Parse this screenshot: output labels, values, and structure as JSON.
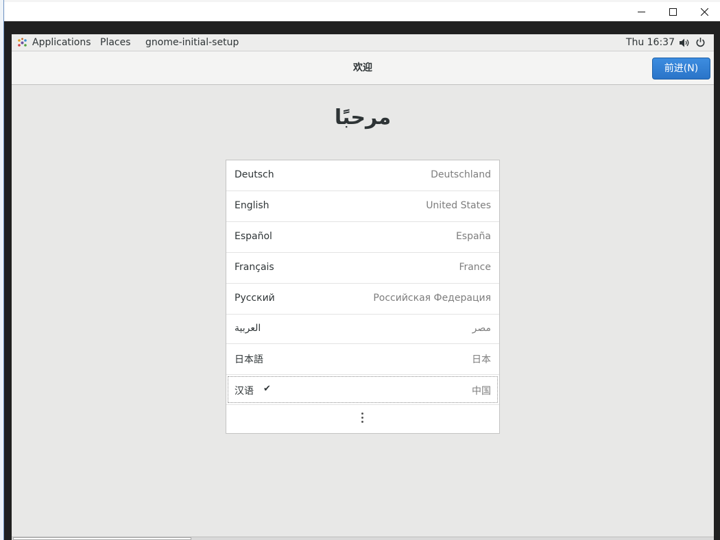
{
  "host_window": {
    "minimize_icon": "minimize-icon",
    "maximize_icon": "maximize-icon",
    "close_icon": "close-icon"
  },
  "topbar": {
    "applications_label": "Applications",
    "places_label": "Places",
    "app_name": "gnome-initial-setup",
    "clock": "Thu 16:37",
    "volume_icon": "volume-icon",
    "power_icon": "power-icon"
  },
  "headerbar": {
    "title": "欢迎",
    "next_button_label": "前进(N)",
    "accent_color": "#2a74c8"
  },
  "welcome_text": "مرحبًا",
  "languages": [
    {
      "name": "Deutsch",
      "region": "Deutschland",
      "selected": false
    },
    {
      "name": "English",
      "region": "United States",
      "selected": false
    },
    {
      "name": "Español",
      "region": "España",
      "selected": false
    },
    {
      "name": "Français",
      "region": "France",
      "selected": false
    },
    {
      "name": "Русский",
      "region": "Российская Федерация",
      "selected": false
    },
    {
      "name": "العربية",
      "region": "مصر",
      "selected": false
    },
    {
      "name": "日本語",
      "region": "日本",
      "selected": false
    },
    {
      "name": "汉语",
      "region": "中国",
      "selected": true
    }
  ],
  "more_icon": "more-vertical-icon",
  "check_glyph": "✔"
}
